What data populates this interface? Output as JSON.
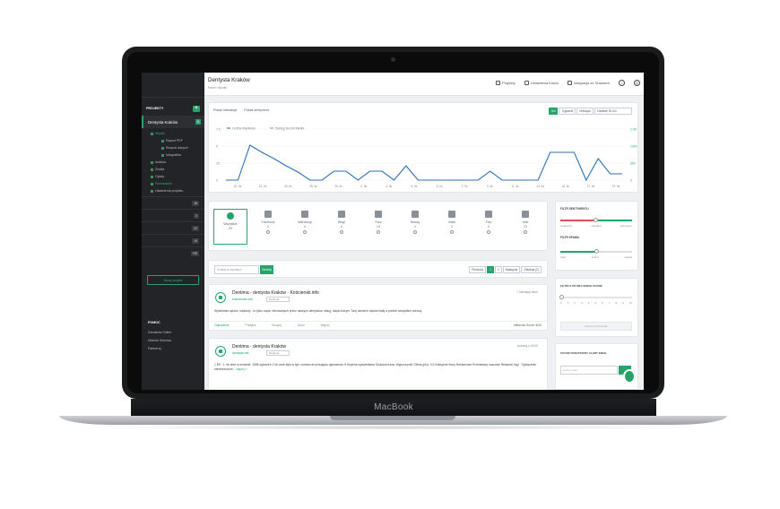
{
  "device": {
    "brand": "MacBook"
  },
  "sidebar": {
    "section_projects": "PROJEKTY",
    "add": "+",
    "active_project": "Dentysta Kraków",
    "active_badge": "6",
    "menu": [
      {
        "label": "Wyniki",
        "level": 0,
        "green": true
      },
      {
        "label": "Raport PDF",
        "level": 1
      },
      {
        "label": "Eksport danych",
        "level": 1
      },
      {
        "label": "Infografika",
        "level": 1
      },
      {
        "label": "Analiza",
        "level": 0
      },
      {
        "label": "Źródła",
        "level": 0
      },
      {
        "label": "Cytaty",
        "level": 0
      },
      {
        "label": "Porównanie",
        "level": 0,
        "green": true
      },
      {
        "label": "Ustawienia projektu",
        "level": 0
      }
    ],
    "counts": [
      "38",
      "0",
      "42",
      "15",
      "+99"
    ],
    "add_project": "Nowy projekt",
    "help_title": "POMOC",
    "help_links": [
      "Szkolenia Online",
      "Historia Sukcesu",
      "Partnerzy"
    ]
  },
  "topbar": {
    "title": "Dentysta Kraków",
    "breadcrumb": "Panel / Wyniki",
    "links": [
      "Projekty",
      "Ustawienia Konta",
      "Integracja ze Slackiem"
    ],
    "help": "?",
    "power": "⏻"
  },
  "chart_card": {
    "tabs": [
      "Pokaż interakcje",
      "Pokaż sentyment"
    ],
    "ranges": [
      "Dni",
      "Tygodnie",
      "Miesiące"
    ],
    "active_range": "Dni",
    "period_select": "Ostatnie 30 dni"
  },
  "chart_data": {
    "type": "line",
    "categories": [
      "22. lis",
      "24. lis",
      "26. lis",
      "28. lis",
      "30. lis",
      "2. gru",
      "4. gru",
      "6. gru",
      "8. gru",
      "10. gru",
      "12. gru",
      "14. gru",
      "16. gru",
      "18. gru",
      "20. gru"
    ],
    "series": [
      {
        "name": "Liczba Wyników",
        "color": "#2e6fb7"
      },
      {
        "name": "Zasięg Social Media",
        "color": "#6aa0d8"
      }
    ],
    "y_left_ticks": [
      "0",
      "25",
      "5",
      "7.5"
    ],
    "y_right_ticks": [
      "0",
      "650",
      "1300",
      "2.0K"
    ],
    "x_labels": [
      "22. lis",
      "24. lis",
      "26. lis",
      "28. lis",
      "30. lis",
      "2. lis",
      "4. lis",
      "6. lis",
      "8. lis",
      "7. lis",
      "9. lis",
      "11. lis",
      "13. lis",
      "15. lis",
      "17. lis",
      "19. lis"
    ]
  },
  "sources": [
    {
      "label": "Wszystkie",
      "count": "29",
      "icon": "globe-icon",
      "active": true
    },
    {
      "label": "Facebook",
      "count": "0",
      "icon": "facebook-icon"
    },
    {
      "label": "Mikroblogi",
      "count": "0",
      "icon": "twitter-icon"
    },
    {
      "label": "Blogi",
      "count": "0",
      "icon": "rss-icon"
    },
    {
      "label": "Fora",
      "count": "15",
      "icon": "chat-icon"
    },
    {
      "label": "Newsy",
      "count": "2",
      "icon": "news-icon"
    },
    {
      "label": "Video",
      "count": "0",
      "icon": "video-icon"
    },
    {
      "label": "Foto",
      "count": "0",
      "icon": "photo-icon"
    },
    {
      "label": "Inne",
      "count": "20",
      "icon": "share-icon"
    }
  ],
  "filters": {
    "sentiment_title": "FILTR SENTYMENTU",
    "sentiment_labels": [
      "negatywny",
      "neutralny",
      "pozytywny"
    ],
    "spam_title": "FILTR SPAMU",
    "spam_labels": [
      "niski",
      "średni",
      "wysoki"
    ],
    "influence_title": "FILTRUJ PO INFLUENCE SCORE",
    "influence_scale": [
      "0",
      "1",
      "2",
      "3",
      "4",
      "5",
      "6",
      "7",
      "8",
      "9",
      "10"
    ],
    "influence_button": "Zastosuj filtrowanie",
    "email_title": "USTAW DODATKOWY ALERT EMAIL",
    "email_placeholder": "podaj email..."
  },
  "search": {
    "placeholder": "Szukaj w wynikach",
    "button": "Szukaj",
    "pages": [
      "Pierwsza",
      "1",
      "2",
      "Następna",
      "Ostatnia (2)"
    ]
  },
  "results": [
    {
      "title": "Dentima - dentysta Kraków - Kościerski.info",
      "source": "kosciernski.info",
      "select": "Dentima",
      "date": "7 miesięcy temu",
      "text": "Wybielanie zębów, implanty - to tylko część oferowanych przez naszych dentystów, usług, dzięki którym Twój uśmiech będzie biały a przede wszystkim zdrowy.",
      "actions": [
        "Odpowiedz",
        "Polityka",
        "Skopiuj",
        "Usuń",
        "Więcej"
      ],
      "influence": "Influence Score: 6/10"
    },
    {
      "title": "Dentima - dentysta Kraków",
      "source": "dentysta.net",
      "select": "Dentima",
      "date": "wczoraj o 09:00",
      "text": "1 Efl · 1. Ile ofert w serwisie: 1698 ogłoszeń 1 Ile osób było w tym momencie przeglądu ogłoszenia: 6 Kryteria wyświetlania Szukana fraza: Wypoczynek Oferta (pln): 0-0 Kategorie Bony Reklamowe Przedstawy czasowe Reklama Tagi · Ogłoszenie zamieszczone...",
      "more": "więcej »"
    }
  ]
}
